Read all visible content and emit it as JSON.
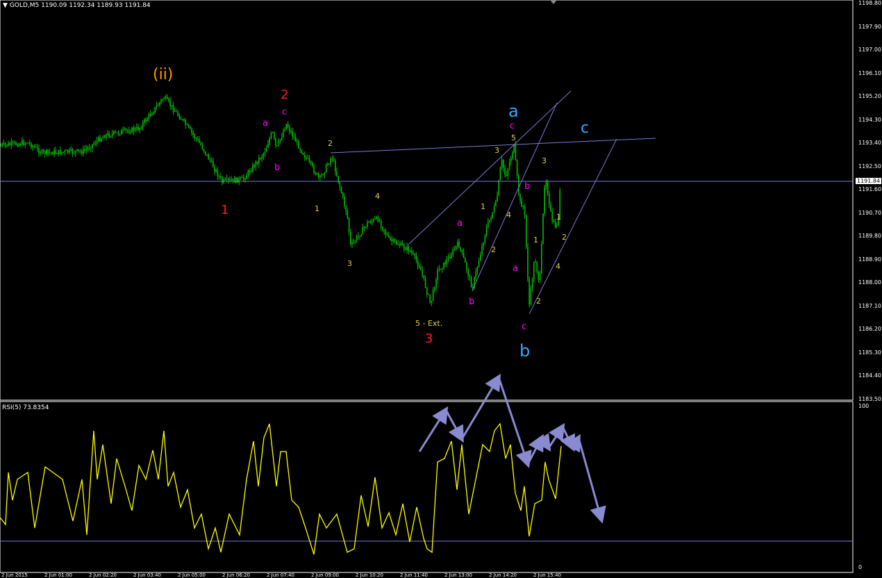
{
  "chart_header": {
    "symbol": "GOLD,M5",
    "open": "1190.09",
    "high": "1192.34",
    "low": "1189.93",
    "close": "1191.84"
  },
  "rsi_header": "RSI(5) 73.8354",
  "price_axis": [
    "1198.80",
    "1197.90",
    "1197.00",
    "1196.10",
    "1195.20",
    "1194.30",
    "1193.40",
    "1192.50",
    "1191.60",
    "1190.70",
    "1189.80",
    "1188.90",
    "1188.00",
    "1187.10",
    "1186.20",
    "1185.30",
    "1184.40",
    "1183.50"
  ],
  "current_price": "1191.84",
  "rsi_axis": {
    "top": "100",
    "bottom": "0"
  },
  "time_axis": [
    "2 Jun 2015",
    "2 Jun 01:00",
    "2 Jun 02:20",
    "2 Jun 03:40",
    "2 Jun 05:00",
    "2 Jun 06:20",
    "2 Jun 07:40",
    "2 Jun 09:00",
    "2 Jun 10:20",
    "2 Jun 11:40",
    "2 Jun 13:00",
    "2 Jun 14:20",
    "2 Jun 15:40"
  ],
  "colors": {
    "background": "#000000",
    "candle": "#00c000",
    "trendline": "#7b7bd6",
    "rsi_line": "#ffff00",
    "arrow": "#8a8ad0",
    "wave_red": "#ff1a1a",
    "wave_magenta": "#ff00ff",
    "wave_cyan": "#33aaff",
    "wave_orange": "#ff9900",
    "wave_small": "#e6d04a"
  },
  "wave_labels": [
    {
      "id": "ii",
      "text": "(ii)",
      "color": "wave_orange"
    },
    {
      "id": "one-red",
      "text": "1",
      "color": "wave_red"
    },
    {
      "id": "two-red",
      "text": "2",
      "color": "wave_red"
    },
    {
      "id": "three-red",
      "text": "3",
      "color": "wave_red"
    },
    {
      "id": "a-mag-1",
      "text": "a",
      "color": "wave_magenta"
    },
    {
      "id": "b-mag-1",
      "text": "b",
      "color": "wave_magenta"
    },
    {
      "id": "c-mag-1",
      "text": "c",
      "color": "wave_magenta"
    },
    {
      "id": "a-mag-2",
      "text": "a",
      "color": "wave_magenta"
    },
    {
      "id": "b-mag-2",
      "text": "b",
      "color": "wave_magenta"
    },
    {
      "id": "c-mag-2",
      "text": "c",
      "color": "wave_magenta"
    },
    {
      "id": "a-mag-3",
      "text": "a",
      "color": "wave_magenta"
    },
    {
      "id": "b-mag-3",
      "text": "b",
      "color": "wave_magenta"
    },
    {
      "id": "c-mag-3",
      "text": "c",
      "color": "wave_magenta"
    },
    {
      "id": "a-cyan",
      "text": "a",
      "color": "wave_cyan"
    },
    {
      "id": "b-cyan",
      "text": "b",
      "color": "wave_cyan"
    },
    {
      "id": "c-cyan",
      "text": "c",
      "color": "wave_cyan"
    },
    {
      "id": "s1",
      "text": "1",
      "color": "wave_small"
    },
    {
      "id": "s2",
      "text": "2",
      "color": "wave_small"
    },
    {
      "id": "s3",
      "text": "3",
      "color": "wave_small"
    },
    {
      "id": "s4",
      "text": "4",
      "color": "wave_small"
    },
    {
      "id": "ext",
      "text": "5 - Ext.",
      "color": "wave_small"
    },
    {
      "id": "s1b",
      "text": "1",
      "color": "wave_small"
    },
    {
      "id": "s2b",
      "text": "2",
      "color": "wave_small"
    },
    {
      "id": "s3b",
      "text": "3",
      "color": "wave_small"
    },
    {
      "id": "s4b",
      "text": "4",
      "color": "wave_small"
    },
    {
      "id": "s5b",
      "text": "5",
      "color": "wave_small"
    },
    {
      "id": "s3c",
      "text": "3",
      "color": "wave_small"
    },
    {
      "id": "s1c",
      "text": "1",
      "color": "wave_small"
    },
    {
      "id": "s2c",
      "text": "2",
      "color": "wave_small"
    },
    {
      "id": "s4c",
      "text": "4",
      "color": "wave_small"
    },
    {
      "id": "s1d",
      "text": "1",
      "color": "wave_small"
    },
    {
      "id": "s2d",
      "text": "2",
      "color": "wave_small"
    }
  ]
}
